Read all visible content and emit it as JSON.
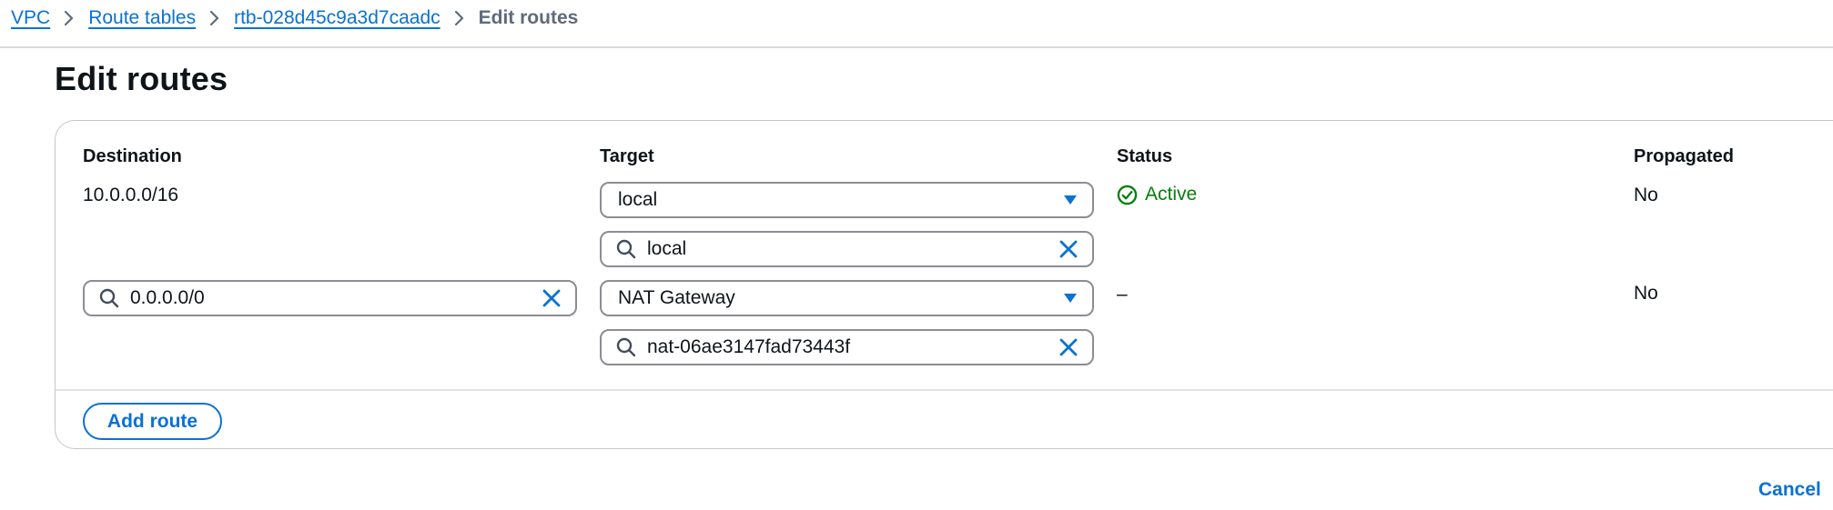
{
  "breadcrumb": {
    "items": [
      {
        "label": "VPC"
      },
      {
        "label": "Route tables"
      },
      {
        "label": "rtb-028d45c9a3d7caadc"
      }
    ],
    "current": "Edit routes"
  },
  "page": {
    "title": "Edit routes"
  },
  "table": {
    "headers": {
      "destination": "Destination",
      "target": "Target",
      "status": "Status",
      "propagated": "Propagated"
    },
    "rows": [
      {
        "destination": "10.0.0.0/16",
        "target_type": "local",
        "target_search": "local",
        "status": "Active",
        "propagated": "No"
      },
      {
        "destination": "0.0.0.0/0",
        "target_type": "NAT Gateway",
        "target_search": "nat-06ae3147fad73443f",
        "status": "–",
        "propagated": "No"
      }
    ]
  },
  "actions": {
    "add_route": "Add route",
    "cancel": "Cancel"
  },
  "icons": {
    "breadcrumb_separator": "chevron-right-icon",
    "search": "search-icon",
    "clear": "close-icon",
    "select_caret": "caret-down-icon",
    "status_ok": "check-circle-icon"
  },
  "colors": {
    "link": "#0972d3",
    "success": "#037f0c",
    "text": "#0f141a",
    "muted": "#5f6b7a",
    "border": "#8c8c94"
  }
}
